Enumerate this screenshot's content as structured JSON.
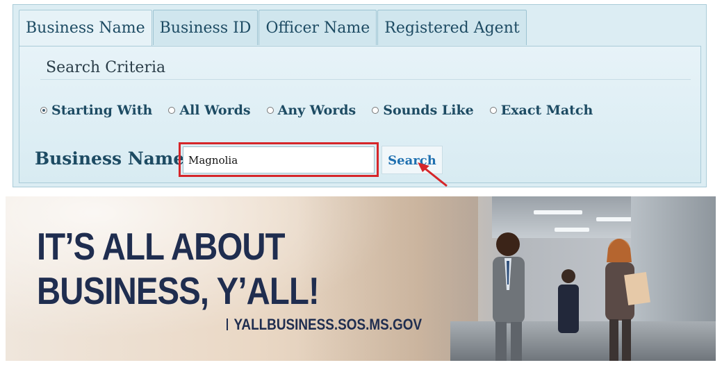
{
  "tabs": [
    {
      "label": "Business Name",
      "active": true
    },
    {
      "label": "Business ID",
      "active": false
    },
    {
      "label": "Officer Name",
      "active": false
    },
    {
      "label": "Registered Agent",
      "active": false
    }
  ],
  "criteria": {
    "title": "Search Criteria",
    "options": [
      {
        "label": "Starting With",
        "checked": true
      },
      {
        "label": "All Words",
        "checked": false
      },
      {
        "label": "Any Words",
        "checked": false
      },
      {
        "label": "Sounds Like",
        "checked": false
      },
      {
        "label": "Exact Match",
        "checked": false
      }
    ]
  },
  "form": {
    "field_label": "Business Name:",
    "field_value": "Magnolia",
    "search_label": "Search"
  },
  "banner": {
    "headline_line1": "IT’S ALL ABOUT",
    "headline_line2": "BUSINESS, Y’ALL!",
    "url": "YALLBUSINESS.SOS.MS.GOV"
  },
  "colors": {
    "accent": "#1d4b63",
    "link": "#1f70b0",
    "highlight": "#d6262a",
    "banner_text": "#1f2d4f"
  }
}
